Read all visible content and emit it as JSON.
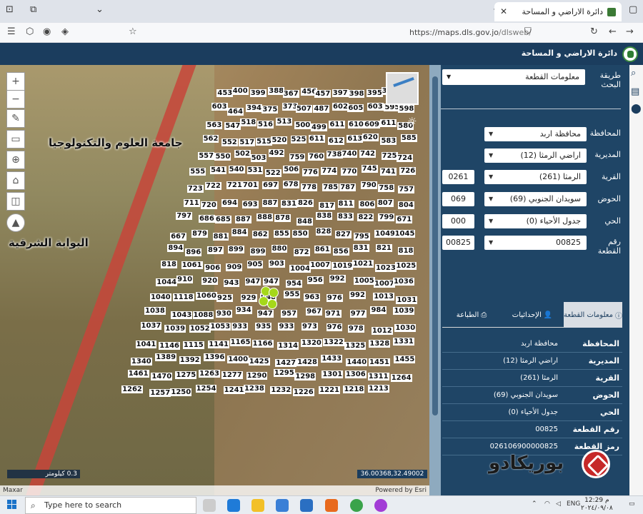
{
  "browser": {
    "tab_title": "دائرة الاراضي و المساحة",
    "url_host": "https://maps.dls.gov.jo",
    "url_path": "/dlsweb/"
  },
  "app": {
    "title": "دائرة الاراضي و المساحة"
  },
  "map": {
    "labels": {
      "university": "جامعة العلوم والتكنولوجيا",
      "gate": "البوابة الشرقية"
    },
    "scale": "0.3 كيلومتر",
    "coords": "36.00368,32.49002",
    "attribution_left": "Maxar",
    "attribution_right": "Powered by Esri",
    "parcels": [
      "453",
      "400",
      "399",
      "388",
      "367",
      "456",
      "457",
      "397",
      "398",
      "395",
      "369",
      "601",
      "603",
      "464",
      "394",
      "375",
      "373",
      "507",
      "487",
      "602",
      "605",
      "603",
      "595",
      "598",
      "563",
      "547",
      "518",
      "516",
      "513",
      "500",
      "499",
      "611",
      "610",
      "609",
      "611",
      "580",
      "562",
      "552",
      "517",
      "515",
      "520",
      "525",
      "611",
      "612",
      "613",
      "620",
      "583",
      "585",
      "557",
      "550",
      "502",
      "503",
      "492",
      "759",
      "760",
      "738",
      "740",
      "742",
      "725",
      "724",
      "555",
      "541",
      "540",
      "531",
      "522",
      "506",
      "776",
      "774",
      "770",
      "745",
      "741",
      "726",
      "723",
      "722",
      "721",
      "701",
      "697",
      "678",
      "778",
      "785",
      "787",
      "790",
      "758",
      "757",
      "711",
      "720",
      "694",
      "693",
      "887",
      "831",
      "826",
      "817",
      "811",
      "806",
      "807",
      "804",
      "797",
      "686",
      "685",
      "887",
      "888",
      "878",
      "848",
      "838",
      "833",
      "822",
      "799",
      "671",
      "667",
      "879",
      "881",
      "884",
      "862",
      "855",
      "850",
      "828",
      "827",
      "795",
      "1049",
      "1045",
      "894",
      "896",
      "897",
      "899",
      "899",
      "880",
      "872",
      "861",
      "856",
      "831",
      "821",
      "818",
      "818",
      "1061",
      "906",
      "909",
      "905",
      "903",
      "1004",
      "1007",
      "1019",
      "1021",
      "1023",
      "1025",
      "1044",
      "910",
      "920",
      "943",
      "947",
      "947",
      "954",
      "956",
      "992",
      "1005",
      "1007",
      "1036",
      "1040",
      "1118",
      "1060",
      "925",
      "929",
      "948",
      "955",
      "963",
      "976",
      "992",
      "1013",
      "1031",
      "1038",
      "1043",
      "1088",
      "930",
      "934",
      "947",
      "957",
      "967",
      "971",
      "977",
      "984",
      "1039",
      "1037",
      "1039",
      "1052",
      "1053",
      "933",
      "935",
      "933",
      "973",
      "976",
      "978",
      "1012",
      "1030",
      "1041",
      "1146",
      "1115",
      "1141",
      "1165",
      "1166",
      "1314",
      "1320",
      "1322",
      "1325",
      "1328",
      "1331",
      "1340",
      "1389",
      "1392",
      "1396",
      "1400",
      "1425",
      "1427",
      "1428",
      "1433",
      "1440",
      "1451",
      "1455",
      "1461",
      "1470",
      "1275",
      "1263",
      "1277",
      "1290",
      "1295",
      "1298",
      "1301",
      "1306",
      "1311",
      "1264",
      "1262",
      "1257",
      "1250",
      "1254",
      "1241",
      "1238",
      "1232",
      "1226",
      "1221",
      "1218",
      "1213"
    ]
  },
  "search": {
    "method_label": "طريقة البحث",
    "method_value": "معلومات القطعة"
  },
  "form": {
    "governorate_label": "المحافظة",
    "governorate_value": "محافظة اربد",
    "directorate_label": "المديرية",
    "directorate_value": "اراضي الرمثا (12)",
    "village_label": "القرية",
    "village_value": "الرمثا (261)",
    "village_code": "0261",
    "basin_label": "الحوض",
    "basin_value": "سويدان الجنوبي (69)",
    "basin_code": "069",
    "district_label": "الحي",
    "district_value": "جدول الأحياء (0)",
    "district_code": "000",
    "parcel_label": "رقم القطعة",
    "parcel_value": "00825",
    "parcel_code": "00825"
  },
  "tabs": {
    "info": "معلومات القطعة",
    "coordinates": "الإحداثيات",
    "print": "الطباعة"
  },
  "info": [
    {
      "key": "المحافظة",
      "value": "محافظة اربد"
    },
    {
      "key": "المديرية",
      "value": "اراضي الرمثا (12)"
    },
    {
      "key": "القرية",
      "value": "الرمثا (261)"
    },
    {
      "key": "الحوض",
      "value": "سويدان الجنوبي (69)"
    },
    {
      "key": "الحي",
      "value": "جدول الأحياء (0)"
    },
    {
      "key": "رقم القطعة",
      "value": "00825"
    },
    {
      "key": "رمز القطعة",
      "value": "026106900000825"
    }
  ],
  "watermark": "بوريكادو",
  "taskbar": {
    "search_placeholder": "Type here to search",
    "language": "ENG",
    "time": "12:29 م",
    "date": "٢٠٢٤/٠٩/٠٨"
  }
}
